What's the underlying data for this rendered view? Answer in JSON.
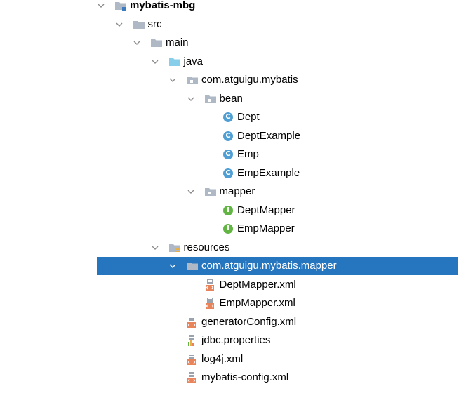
{
  "tree": {
    "items": [
      {
        "label": "mybatis-mbg",
        "depth": 0,
        "icon": "module-folder-icon",
        "expanded": true,
        "bold": true
      },
      {
        "label": "src",
        "depth": 1,
        "icon": "folder-icon",
        "expanded": true
      },
      {
        "label": "main",
        "depth": 2,
        "icon": "folder-icon",
        "expanded": true
      },
      {
        "label": "java",
        "depth": 3,
        "icon": "source-folder-icon",
        "expanded": true
      },
      {
        "label": "com.atguigu.mybatis",
        "depth": 4,
        "icon": "package-icon",
        "expanded": true
      },
      {
        "label": "bean",
        "depth": 5,
        "icon": "package-icon",
        "expanded": true
      },
      {
        "label": "Dept",
        "depth": 6,
        "icon": "java-class-icon"
      },
      {
        "label": "DeptExample",
        "depth": 6,
        "icon": "java-class-icon"
      },
      {
        "label": "Emp",
        "depth": 6,
        "icon": "java-class-icon"
      },
      {
        "label": "EmpExample",
        "depth": 6,
        "icon": "java-class-icon"
      },
      {
        "label": "mapper",
        "depth": 5,
        "icon": "package-icon",
        "expanded": true
      },
      {
        "label": "DeptMapper",
        "depth": 6,
        "icon": "java-interface-icon"
      },
      {
        "label": "EmpMapper",
        "depth": 6,
        "icon": "java-interface-icon"
      },
      {
        "label": "resources",
        "depth": 3,
        "icon": "resources-folder-icon",
        "expanded": true
      },
      {
        "label": "com.atguigu.mybatis.mapper",
        "depth": 4,
        "icon": "folder-icon",
        "expanded": true,
        "selected": true
      },
      {
        "label": "DeptMapper.xml",
        "depth": 5,
        "icon": "xml-file-icon"
      },
      {
        "label": "EmpMapper.xml",
        "depth": 5,
        "icon": "xml-file-icon"
      },
      {
        "label": "generatorConfig.xml",
        "depth": 4,
        "icon": "xml-file-icon"
      },
      {
        "label": "jdbc.properties",
        "depth": 4,
        "icon": "properties-file-icon"
      },
      {
        "label": "log4j.xml",
        "depth": 4,
        "icon": "xml-file-icon"
      },
      {
        "label": "mybatis-config.xml",
        "depth": 4,
        "icon": "xml-file-icon"
      }
    ]
  },
  "colors": {
    "selection": "#2675bf",
    "folder": "#aeb9c5",
    "source_folder": "#87ceeb",
    "class_icon": "#4f9fd4",
    "interface_icon": "#62b543",
    "xml_icon": "#e8845c"
  }
}
